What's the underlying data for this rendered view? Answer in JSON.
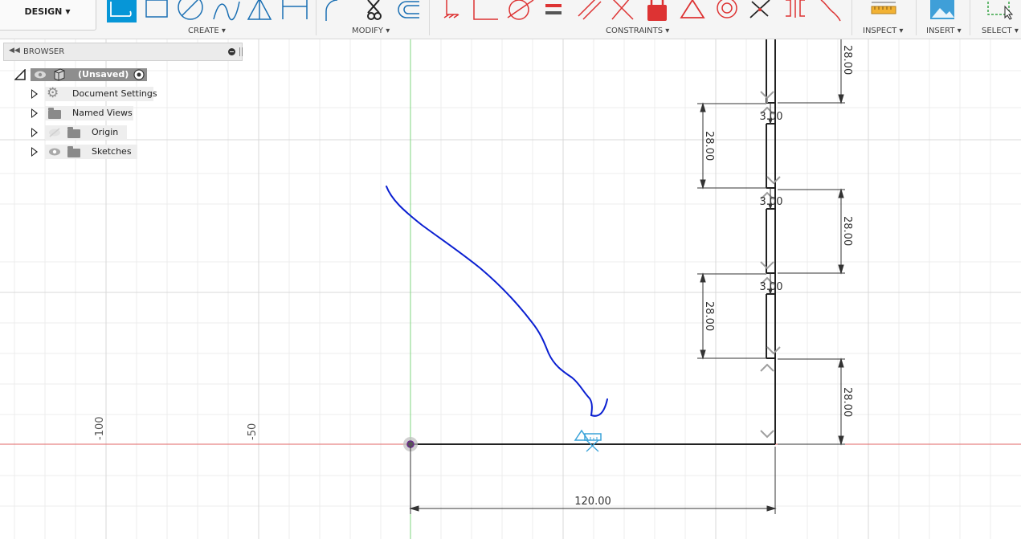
{
  "toolbar": {
    "design_label": "DESIGN",
    "groups": {
      "create": "CREATE",
      "modify": "MODIFY",
      "constraints": "CONSTRAINTS",
      "inspect": "INSPECT",
      "insert": "INSERT",
      "select": "SELECT"
    },
    "accent_color": "#0696d7"
  },
  "browser": {
    "title": "BROWSER",
    "root": {
      "label": "(Unsaved)"
    },
    "items": [
      {
        "label": "Document Settings",
        "icon": "gear-icon"
      },
      {
        "label": "Named Views",
        "icon": "folder-icon"
      },
      {
        "label": "Origin",
        "icon": "folder-icon",
        "visibility": "hidden"
      },
      {
        "label": "Sketches",
        "icon": "folder-icon",
        "visibility": "visible"
      }
    ]
  },
  "sketch": {
    "axis_labels": {
      "minus100": "-100",
      "minus50": "-50"
    },
    "dimensions": {
      "base_length": "120.00",
      "vertical_28": [
        "28.00",
        "28.00",
        "28.00",
        "28.00",
        "28.00"
      ],
      "gap_3": [
        "3.00",
        "3.00",
        "3.00"
      ]
    },
    "colors": {
      "x_axis": "#e06666",
      "y_axis": "#7fd67f",
      "annotation": "#0a1fd1",
      "constraint": "#9e9e9e"
    }
  }
}
